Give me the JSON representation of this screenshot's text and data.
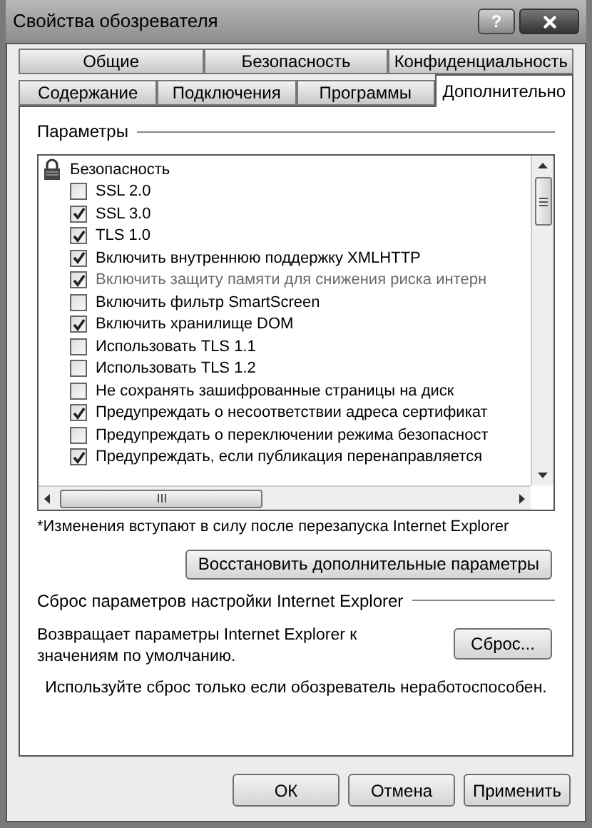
{
  "window": {
    "title": "Свойства обозревателя",
    "help": "?"
  },
  "tab_rows": [
    [
      {
        "label": "Общие",
        "selected": false
      },
      {
        "label": "Безопасность",
        "selected": false
      },
      {
        "label": "Конфиденциальность",
        "selected": false
      }
    ],
    [
      {
        "label": "Содержание",
        "selected": false
      },
      {
        "label": "Подключения",
        "selected": false
      },
      {
        "label": "Программы",
        "selected": false
      },
      {
        "label": "Дополнительно",
        "selected": true
      }
    ]
  ],
  "settings": {
    "title": "Параметры",
    "group": "Безопасность",
    "items": [
      {
        "label": "SSL 2.0",
        "checked": false,
        "disabled": false
      },
      {
        "label": "SSL 3.0",
        "checked": true,
        "disabled": false
      },
      {
        "label": "TLS 1.0",
        "checked": true,
        "disabled": false
      },
      {
        "label": "Включить внутреннюю поддержку XMLHTTP",
        "checked": true,
        "disabled": false
      },
      {
        "label": "Включить защиту памяти для снижения риска интерн",
        "checked": true,
        "disabled": true
      },
      {
        "label": "Включить фильтр SmartScreen",
        "checked": false,
        "disabled": false
      },
      {
        "label": "Включить хранилище DOM",
        "checked": true,
        "disabled": false
      },
      {
        "label": "Использовать TLS 1.1",
        "checked": false,
        "disabled": false
      },
      {
        "label": "Использовать TLS 1.2",
        "checked": false,
        "disabled": false
      },
      {
        "label": "Не сохранять зашифрованные страницы на диск",
        "checked": false,
        "disabled": false
      },
      {
        "label": "Предупреждать о несоответствии адреса сертификат",
        "checked": true,
        "disabled": false
      },
      {
        "label": "Предупреждать о переключении режима безопасност",
        "checked": false,
        "disabled": false
      },
      {
        "label": "Предупреждать, если публикация перенаправляется",
        "checked": true,
        "disabled": false
      }
    ],
    "note": "*Изменения вступают в силу после перезапуска Internet Explorer",
    "restore_button": "Восстановить дополнительные параметры"
  },
  "reset": {
    "title": "Сброс параметров настройки Internet Explorer",
    "description": "Возвращает параметры Internet Explorer к значениям по умолчанию.",
    "button": "Сброс...",
    "warning": "Используйте сброс только если обозреватель неработоспособен."
  },
  "buttons": [
    "ОК",
    "Отмена",
    "Применить"
  ]
}
